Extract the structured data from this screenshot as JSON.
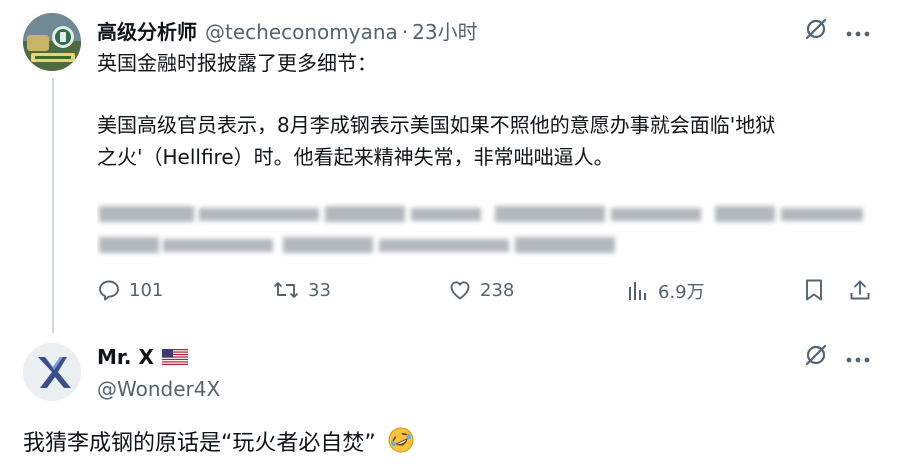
{
  "tweet": {
    "author_name": "高级分析师",
    "author_handle": "@techeconomyana",
    "separator": "·",
    "time": "23小时",
    "lines": [
      "英国金融时报披露了更多细节：",
      "美国高级官员表示，8月李成钢表示美国如果不照他的意愿办事就会面临'地狱",
      "之火'（Hellfire）时。他看起来精神失常，非常咄咄逼人。"
    ],
    "blurred_lines": 2,
    "stats": {
      "replies": "101",
      "retweets": "33",
      "likes": "238",
      "views": "6.9万"
    },
    "icons": {
      "reply": "reply-icon",
      "retweet": "retweet-icon",
      "like": "heart-icon",
      "views": "views-icon",
      "bookmark": "bookmark-icon",
      "share": "share-icon",
      "grok": "grok-icon",
      "more": "more-icon"
    }
  },
  "reply": {
    "author_name": "Mr. X",
    "author_handle": "@Wonder4X",
    "text": "我猜李成钢的原话是“玩火者必自焚”",
    "flag": "us-flag-icon",
    "emoji": "rofl-emoji"
  },
  "colors": {
    "text_primary": "#0f1419",
    "text_secondary": "#536471",
    "thread_line": "#cfd9de"
  }
}
